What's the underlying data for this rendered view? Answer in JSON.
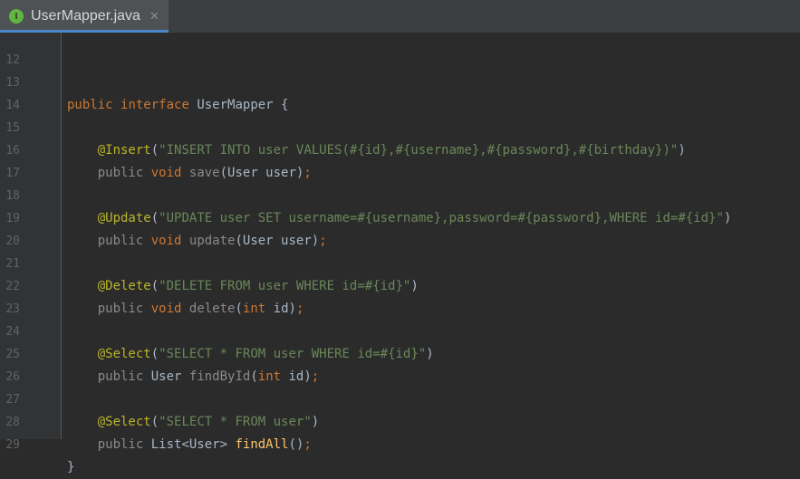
{
  "tab": {
    "title": "UserMapper.java",
    "icon_letter": "I",
    "close": "✕"
  },
  "lines": [
    {
      "num": "12",
      "text": ""
    },
    {
      "num": "13",
      "text": "public interface UserMapper {"
    },
    {
      "num": "14",
      "text": ""
    },
    {
      "num": "15",
      "text": "    @Insert(\"INSERT INTO user VALUES(#{id},#{username},#{password},#{birthday})\")"
    },
    {
      "num": "16",
      "text": "    public void save(User user);"
    },
    {
      "num": "17",
      "text": ""
    },
    {
      "num": "18",
      "text": "    @Update(\"UPDATE user SET username=#{username},password=#{password},WHERE id=#{id}\")"
    },
    {
      "num": "19",
      "text": "    public void update(User user);"
    },
    {
      "num": "20",
      "text": ""
    },
    {
      "num": "21",
      "text": "    @Delete(\"DELETE FROM user WHERE id=#{id}\")"
    },
    {
      "num": "22",
      "text": "    public void delete(int id);"
    },
    {
      "num": "23",
      "text": ""
    },
    {
      "num": "24",
      "text": "    @Select(\"SELECT * FROM user WHERE id=#{id}\")"
    },
    {
      "num": "25",
      "text": "    public User findById(int id);"
    },
    {
      "num": "26",
      "text": ""
    },
    {
      "num": "27",
      "text": "    @Select(\"SELECT * FROM user\")"
    },
    {
      "num": "28",
      "text": "    public List<User> findAll();"
    },
    {
      "num": "29",
      "text": "}"
    }
  ],
  "tokens": {
    "l13": [
      "public",
      "interface",
      "UserMapper {"
    ],
    "l15": [
      "@Insert",
      "(",
      "\"INSERT INTO user VALUES(#{id},#{username},#{password},#{birthday})\"",
      ")"
    ],
    "l16": [
      "public",
      "void",
      "save",
      "(User user)",
      ";"
    ],
    "l18": [
      "@Update",
      "(",
      "\"UPDATE user SET username=#{username},password=#{password},WHERE id=#{id}\"",
      ")"
    ],
    "l19": [
      "public",
      "void",
      "update",
      "(User user)",
      ";"
    ],
    "l21": [
      "@Delete",
      "(",
      "\"DELETE FROM user WHERE id=#{id}\"",
      ")"
    ],
    "l22": [
      "public",
      "void",
      "delete",
      "(",
      "int",
      "id)",
      ";"
    ],
    "l24": [
      "@Select",
      "(",
      "\"SELECT * FROM user WHERE id=#{id}\"",
      ")"
    ],
    "l25": [
      "public",
      "User",
      "findById",
      "(",
      "int",
      "id)",
      ";"
    ],
    "l27": [
      "@Select",
      "(",
      "\"SELECT * FROM user\"",
      ")"
    ],
    "l28": [
      "public",
      "List<User>",
      "findAll",
      "()",
      ";"
    ],
    "l29": [
      "}"
    ]
  },
  "colors": {
    "background": "#2b2b2b",
    "gutter": "#313335",
    "keyword": "#cc7832",
    "annotation": "#bbb529",
    "string": "#6a8759",
    "method_decl": "#ffc66d",
    "text": "#a9b7c6",
    "line_number": "#606366",
    "tab_underline": "#4a88c7"
  }
}
